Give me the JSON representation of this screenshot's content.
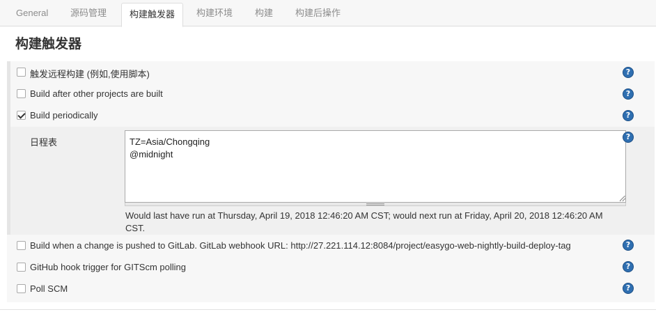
{
  "tabs": [
    {
      "label": "General",
      "active": false
    },
    {
      "label": "源码管理",
      "active": false
    },
    {
      "label": "构建触发器",
      "active": true
    },
    {
      "label": "构建环境",
      "active": false
    },
    {
      "label": "构建",
      "active": false
    },
    {
      "label": "构建后操作",
      "active": false
    }
  ],
  "section": {
    "title": "构建触发器"
  },
  "triggers": [
    {
      "label": "触发远程构建 (例如,使用脚本)",
      "checked": false
    },
    {
      "label": "Build after other projects are built",
      "checked": false
    },
    {
      "label": "Build periodically",
      "checked": true
    },
    {
      "label": "Build when a change is pushed to GitLab. GitLab webhook URL: http://27.221.114.12:8084/project/easygo-web-nightly-build-deploy-tag",
      "checked": false
    },
    {
      "label": "GitHub hook trigger for GITScm polling",
      "checked": false
    },
    {
      "label": "Poll SCM",
      "checked": false
    }
  ],
  "schedule": {
    "label": "日程表",
    "lines": [
      "TZ=Asia/Chongqing",
      "@midnight"
    ],
    "next_run_note": "Would last have run at Thursday, April 19, 2018 12:46:20 AM CST; would next run at Friday, April 20, 2018 12:46:20 AM CST."
  },
  "help": {
    "glyph": "?",
    "icon": "help-icon",
    "color": "#2f6fb1"
  },
  "colors": {
    "tab_bar": "#f7f7f7",
    "panel": "#f7f7f7",
    "help_blue": "#2f6fb1"
  }
}
